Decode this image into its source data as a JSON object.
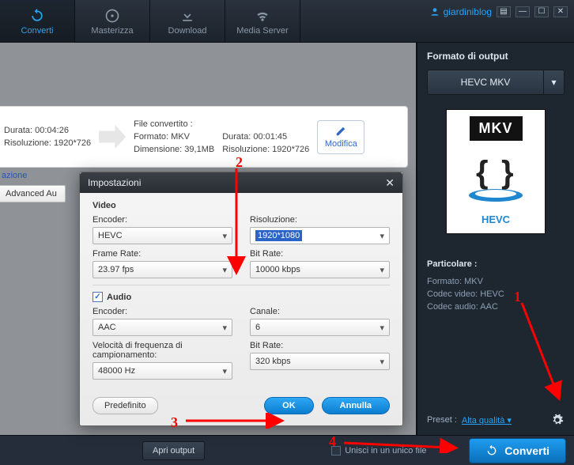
{
  "topbar": {
    "tabs": [
      "Converti",
      "Masterizza",
      "Download",
      "Media Server"
    ],
    "account": "giardiniblog"
  },
  "file": {
    "src": {
      "durata": "Durata: 00:04:26",
      "risoluzione": "Risoluzione: 1920*726"
    },
    "dst_header": "File convertito :",
    "dst": {
      "formato": "Formato: MKV",
      "dimensione": "Dimensione: 39,1MB",
      "durata": "Durata: 00:01:45",
      "risoluzione": "Risoluzione: 1920*726"
    },
    "modifica": "Modifica",
    "link": "azione",
    "adv": "Advanced Au"
  },
  "dialog": {
    "title": "Impostazioni",
    "video_h": "Video",
    "audio_h": "Audio",
    "labels": {
      "venc": "Encoder:",
      "vres": "Risoluzione:",
      "vfr": "Frame Rate:",
      "vbr": "Bit Rate:",
      "aenc": "Encoder:",
      "ach": "Canale:",
      "asr": "Velocità di frequenza di campionamento:",
      "abr": "Bit Rate:"
    },
    "values": {
      "venc": "HEVC",
      "vres": "1920*1080",
      "vfr": "23.97 fps",
      "vbr": "10000 kbps",
      "aenc": "AAC",
      "ach": "6",
      "asr": "48000 Hz",
      "abr": "320 kbps"
    },
    "default_btn": "Predefinito",
    "ok": "OK",
    "cancel": "Annulla"
  },
  "right": {
    "heading": "Formato di output",
    "format_btn": "HEVC MKV",
    "badge": "MKV",
    "codec_label": "HEVC",
    "part_h": "Particolare :",
    "rows": {
      "fmt": "Formato: MKV",
      "vc": "Codec video: HEVC",
      "ac": "Codec audio: AAC"
    },
    "preset_lbl": "Preset :",
    "preset_val": "Alta qualità"
  },
  "bottom": {
    "apri": "Apri output",
    "unisci": "Unisci in un unico file",
    "converti": "Converti"
  },
  "anno": {
    "n1": "1",
    "n2": "2",
    "n3": "3",
    "n4": "4"
  }
}
